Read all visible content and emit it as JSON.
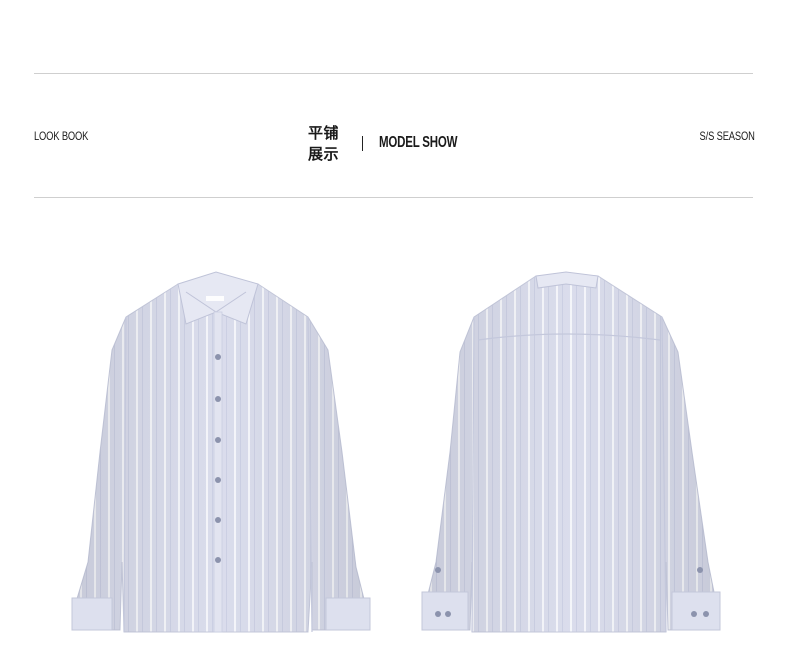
{
  "header": {
    "left_label": "LOOK BOOK",
    "center_cn": "平铺展示",
    "center_separator": "|",
    "center_en": "MODEL SHOW",
    "right_label": "S/S SEASON"
  },
  "products": [
    {
      "name": "shirt-front-view",
      "color": "#d9dcec",
      "stripe_color": "#f6f7fb",
      "button_color": "#8c93ad"
    },
    {
      "name": "shirt-back-view",
      "color": "#d9dcec",
      "stripe_color": "#f6f7fb",
      "button_color": "#8c93ad"
    }
  ]
}
